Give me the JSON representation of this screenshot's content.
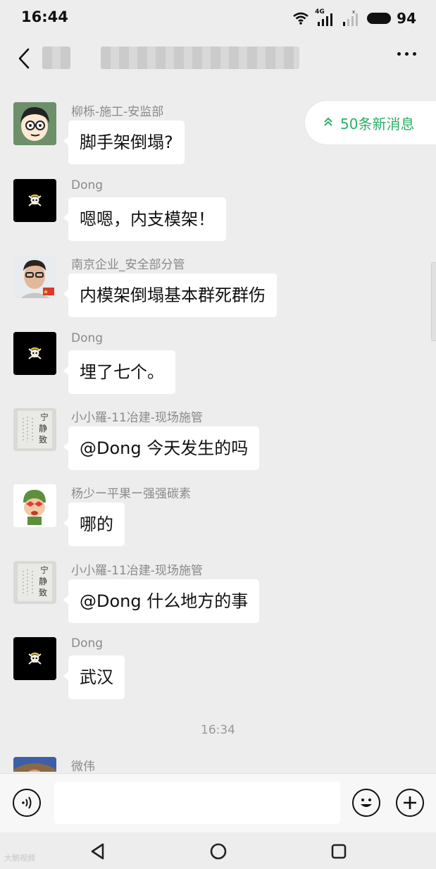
{
  "status_bar": {
    "time": "16:44",
    "network": "4G",
    "battery": "94"
  },
  "header": {
    "title_blurred": true
  },
  "new_messages": {
    "label": "50条新消息"
  },
  "messages": [
    {
      "sender": "柳栎-施工-安监部",
      "text": "脚手架倒塌?"
    },
    {
      "sender": "Dong",
      "text": "嗯嗯，内支模架！"
    },
    {
      "sender": "南京企业_安全部分管",
      "text": "内模架倒塌基本群死群伤"
    },
    {
      "sender": "Dong",
      "text": "埋了七个。"
    },
    {
      "sender": "小小羅-11冶建-现场施管",
      "text": "@Dong  今天发生的吗"
    },
    {
      "sender": "杨少ー平果ー强强碳素",
      "text": "哪的"
    },
    {
      "sender": "小小羅-11冶建-现场施管",
      "text": "@Dong  什么地方的事"
    },
    {
      "sender": "Dong",
      "text": "武汉"
    }
  ],
  "timestamp": "16:34",
  "partial_message": {
    "sender": "微伟"
  },
  "watermark": "大鹅视频",
  "colors": {
    "accent_green": "#2aae67",
    "background": "#ededed",
    "bubble": "#ffffff"
  }
}
